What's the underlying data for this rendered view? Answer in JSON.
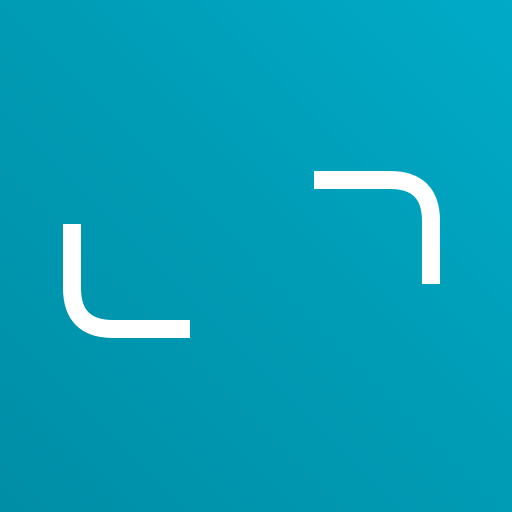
{
  "icon": {
    "name": "expand-frame-icon",
    "colors": {
      "background_start": "#00abc8",
      "background_mid": "#009cb6",
      "background_end": "#008ea6",
      "glyph": "#ffffff"
    }
  }
}
